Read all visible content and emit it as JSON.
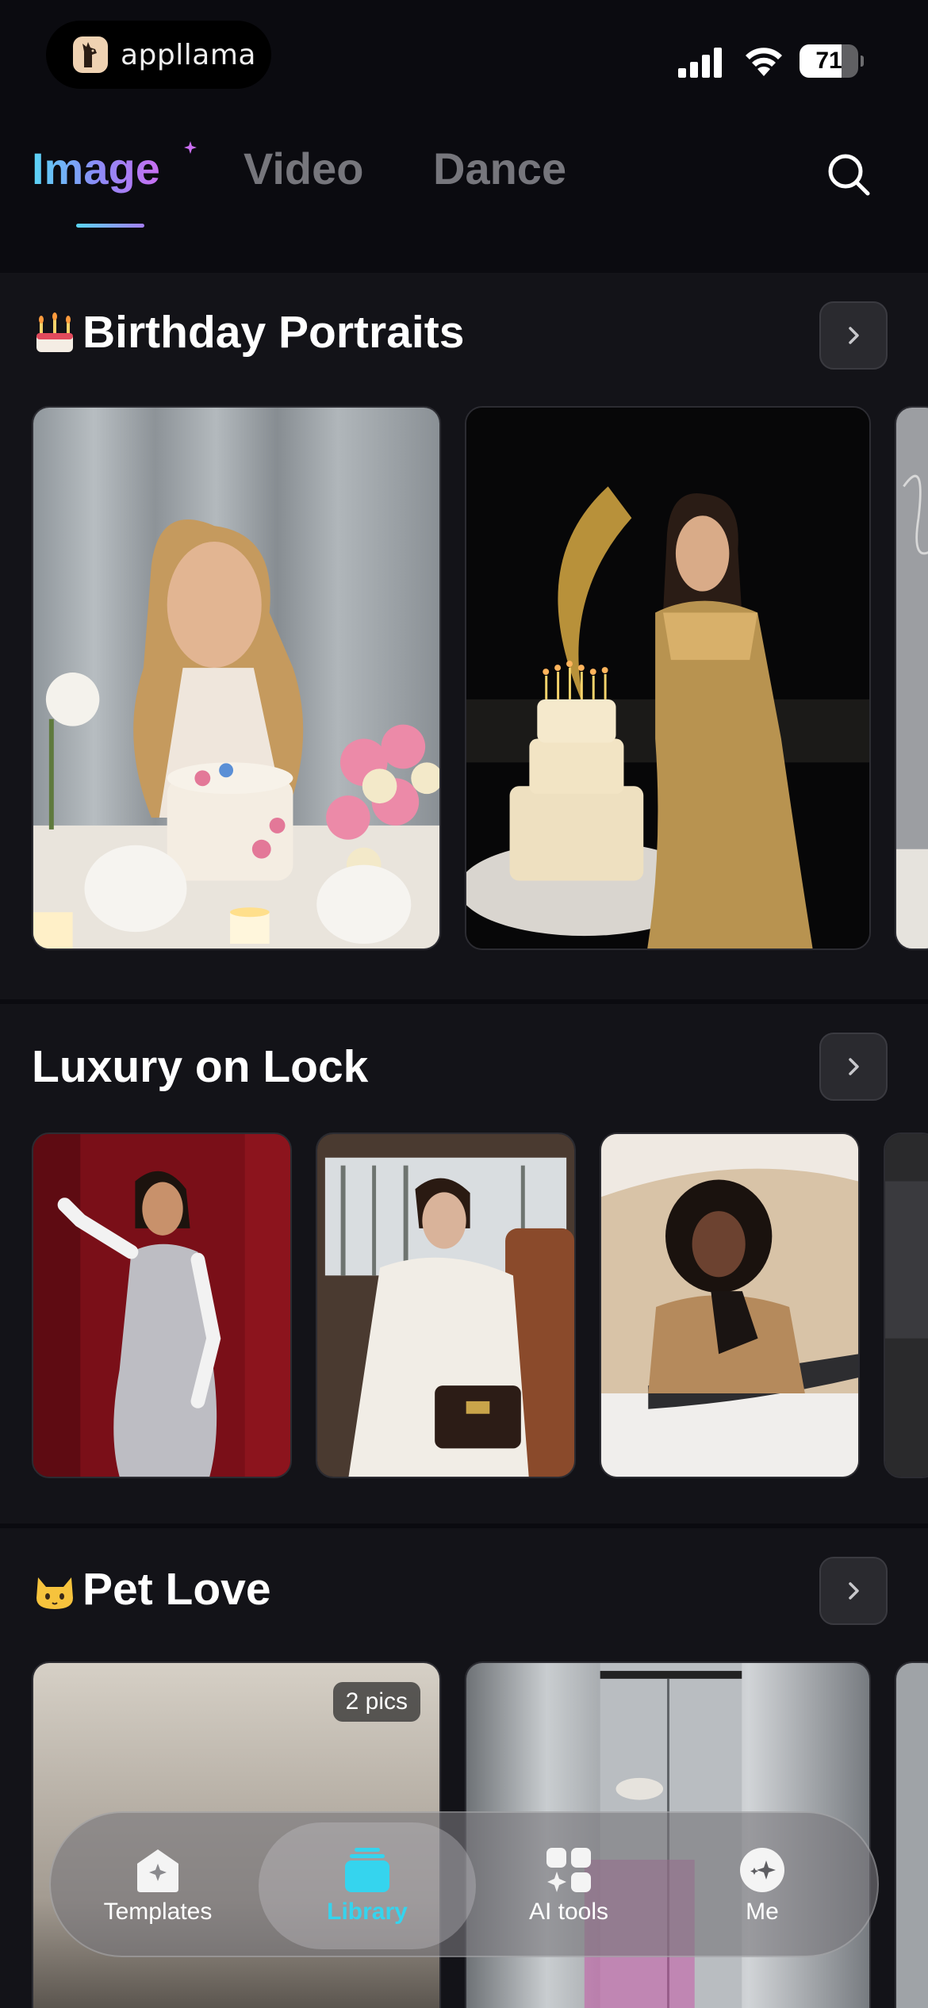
{
  "status_bar": {
    "app_name": "appllama",
    "battery_level": "71",
    "battery_fraction": 0.71
  },
  "tabs": [
    {
      "label": "Image",
      "active": true
    },
    {
      "label": "Video",
      "active": false
    },
    {
      "label": "Dance",
      "active": false
    }
  ],
  "sections": {
    "birthday": {
      "title": "Birthday Portraits",
      "emoji_icon": "cake-emoji-icon"
    },
    "luxury": {
      "title": "Luxury on Lock"
    },
    "pet": {
      "title": "Pet Love",
      "emoji_icon": "cat-emoji-icon",
      "first_card_badge": "2 pics"
    }
  },
  "bottom_nav": [
    {
      "label": "Templates",
      "icon": "templates-icon",
      "active": false
    },
    {
      "label": "Library",
      "icon": "library-icon",
      "active": true
    },
    {
      "label": "AI tools",
      "icon": "ai-tools-icon",
      "active": false
    },
    {
      "label": "Me",
      "icon": "me-icon",
      "active": false
    }
  ],
  "colors": {
    "background": "#0b0b10",
    "section_background": "#131318",
    "accent_gradient_start": "#5ad6f6",
    "accent_gradient_end": "#c96ef2",
    "active_nav": "#35d4ee",
    "inactive_tab": "#76767c"
  }
}
